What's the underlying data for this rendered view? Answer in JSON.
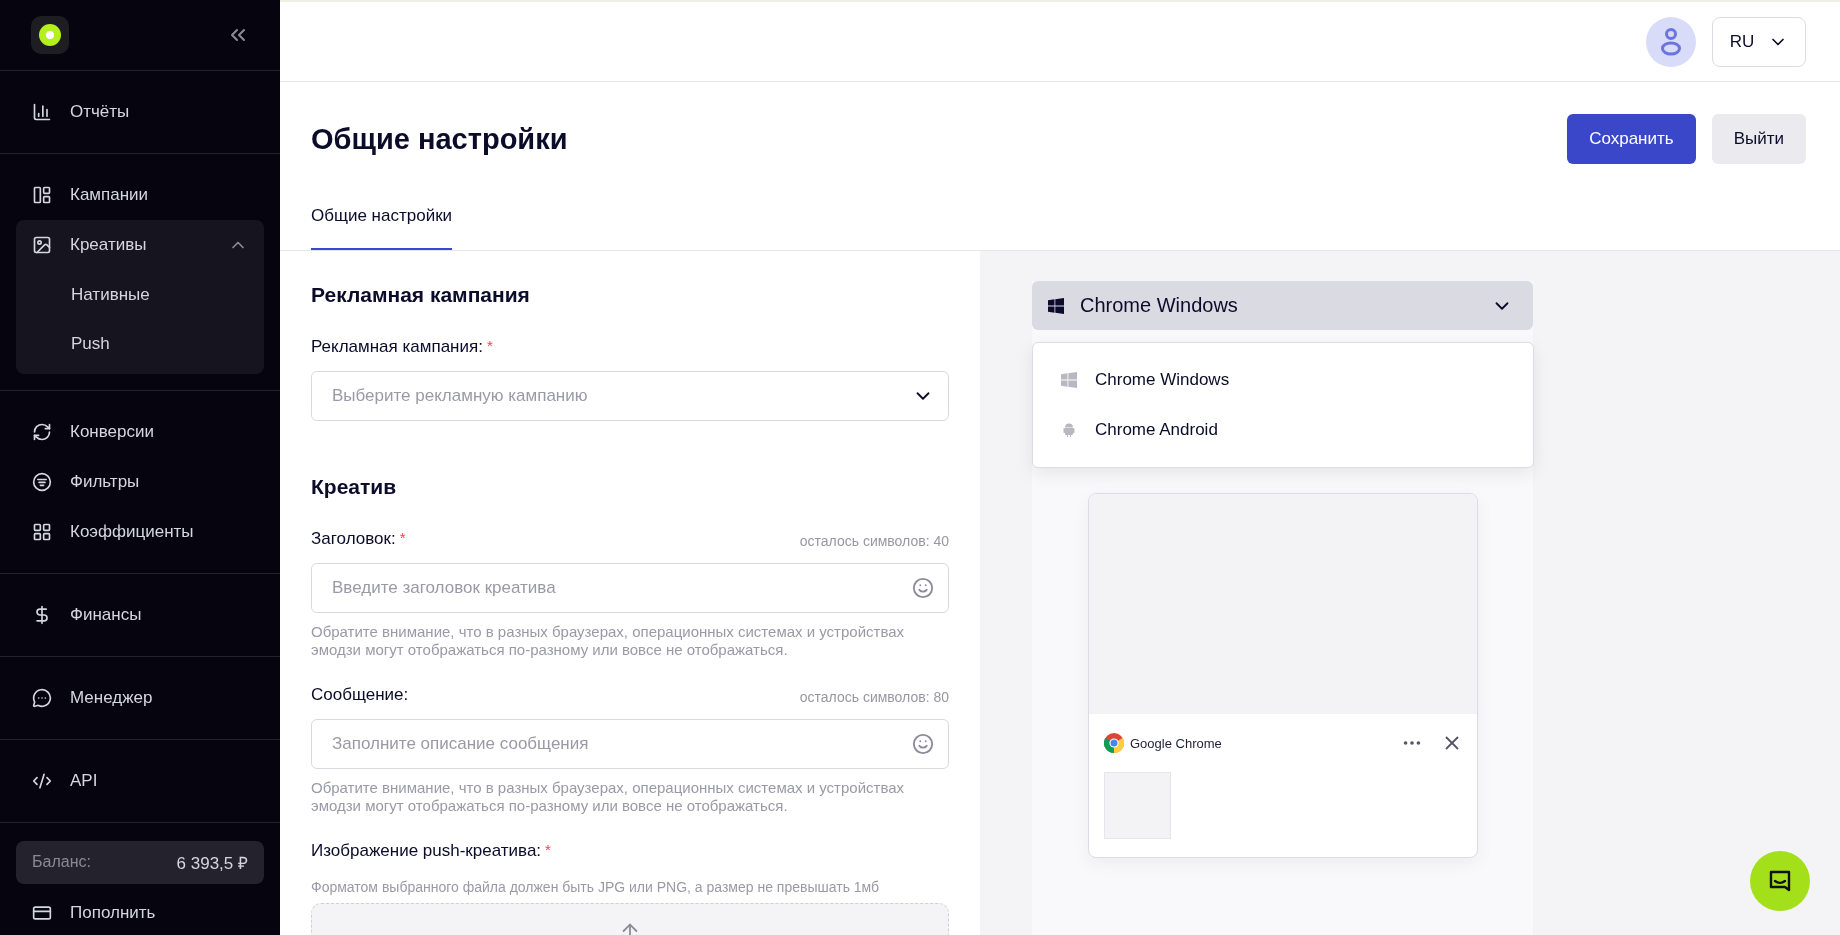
{
  "sidebar": {
    "sections": [
      {
        "items": [
          {
            "kind": "link",
            "label": "Отчёты"
          }
        ]
      },
      {
        "items": [
          {
            "kind": "link",
            "label": "Кампании"
          },
          {
            "kind": "group",
            "label": "Креативы",
            "expanded": true,
            "children": [
              {
                "label": "Нативные"
              },
              {
                "label": "Push"
              }
            ]
          }
        ]
      },
      {
        "items": [
          {
            "kind": "link",
            "label": "Конверсии"
          },
          {
            "kind": "link",
            "label": "Фильтры"
          },
          {
            "kind": "link",
            "label": "Коэффициенты"
          }
        ]
      },
      {
        "items": [
          {
            "kind": "link",
            "label": "Финансы"
          }
        ]
      },
      {
        "items": [
          {
            "kind": "link",
            "label": "Менеджер"
          }
        ]
      },
      {
        "items": [
          {
            "kind": "link",
            "label": "API"
          }
        ]
      }
    ],
    "balance": {
      "label": "Баланс:",
      "value": "6 393,5 ₽"
    },
    "topup": "Пополнить"
  },
  "header": {
    "language": "RU"
  },
  "page": {
    "title": "Общие настройки",
    "buttons": [
      {
        "label": "Сохранить",
        "kind": "primary"
      },
      {
        "label": "Выйти",
        "kind": "secondary"
      }
    ],
    "tabs": [
      {
        "label": "Общие настройки",
        "selected": true
      }
    ]
  },
  "form": {
    "sections": [
      {
        "title": "Рекламная кампания",
        "fields": [
          {
            "kind": "select",
            "label": "Рекламная кампания:",
            "required_mark": "*",
            "placeholder": "Выберите рекламную кампанию"
          }
        ]
      },
      {
        "title": "Креатив",
        "fields": [
          {
            "kind": "text",
            "label": "Заголовок:",
            "required_mark": "*",
            "counter": "осталось символов: 40",
            "placeholder": "Введите заголовок креатива",
            "hint": "Обратите внимание, что в разных браузерах, операционных системах и устройствах эмодзи могут отображаться по-разному или вовсе не отображаться."
          },
          {
            "kind": "text",
            "label": "Сообщение:",
            "counter": "осталось символов: 80",
            "placeholder": "Заполните описание сообщения",
            "hint": "Обратите внимание, что в разных браузерах, операционных системах и устройствах эмодзи могут отображаться по-разному или вовсе не отображаться."
          },
          {
            "kind": "upload",
            "label": "Изображение push-креатива:",
            "required_mark": "*",
            "hint": "Форматом выбранного файла должен быть JPG или PNG, а размер не превышать 1мб"
          }
        ]
      }
    ]
  },
  "preview": {
    "platform": {
      "value": "Chrome Windows",
      "kind": "windows",
      "expanded": true
    },
    "options": [
      {
        "label": "Chrome Windows",
        "kind": "windows"
      },
      {
        "label": "Chrome Android",
        "kind": "android"
      }
    ],
    "notification": {
      "browser": "Google Chrome"
    }
  }
}
